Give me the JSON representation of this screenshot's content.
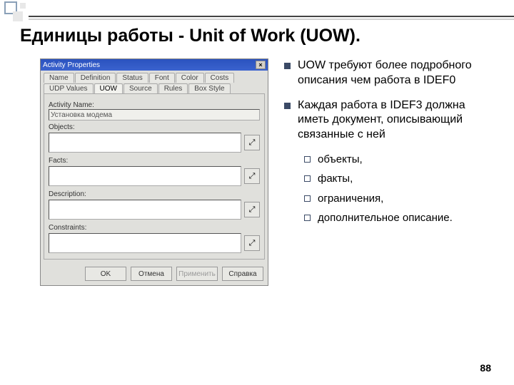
{
  "decor": {},
  "slide": {
    "title": "Единицы работы - Unit of Work (UOW).",
    "page_number": "88"
  },
  "dialog": {
    "title": "Activity Properties",
    "tabs_row1": [
      "Name",
      "Definition",
      "Status",
      "Font",
      "Color",
      "Costs"
    ],
    "tabs_row2": [
      "UDP Values",
      "UOW",
      "Source",
      "Rules",
      "Box Style"
    ],
    "active_tab": "UOW",
    "activity_name_label": "Activity Name:",
    "activity_name_value": "Установка модема",
    "objects_label": "Objects:",
    "facts_label": "Facts:",
    "description_label": "Description:",
    "constraints_label": "Constraints:",
    "zoom_icon": "⤢",
    "buttons": {
      "ok": "OK",
      "cancel": "Отмена",
      "apply": "Применить",
      "help": "Справка"
    }
  },
  "bullets": {
    "items": [
      "UOW требуют более подробного описания чем работа в IDEF0",
      "Каждая работа в IDEF3 должна иметь документ, описывающий связанные с ней"
    ],
    "subitems": [
      "объекты,",
      "факты,",
      "ограничения,",
      "дополнительное описание."
    ]
  }
}
